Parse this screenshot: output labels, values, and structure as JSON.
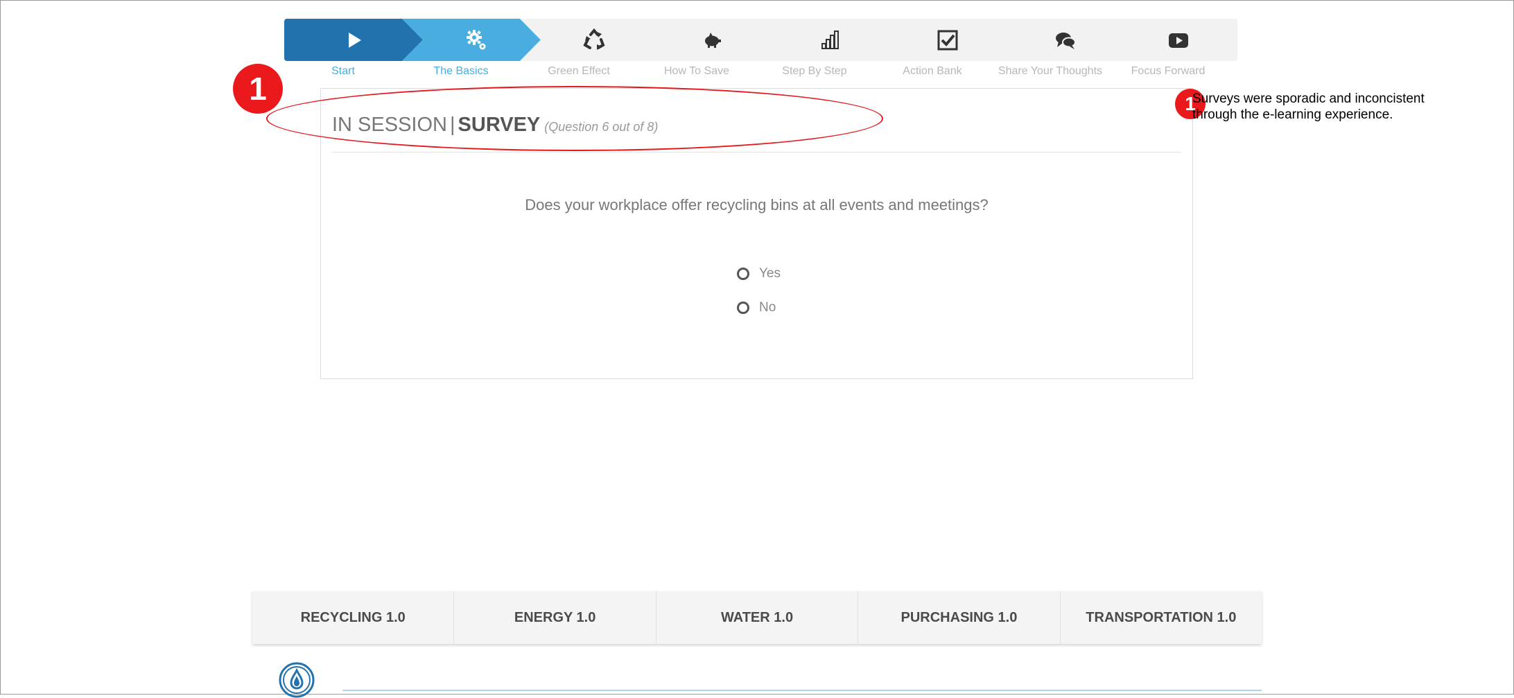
{
  "steps": [
    {
      "label": "Start",
      "icon": "play-icon",
      "state": "done"
    },
    {
      "label": "The Basics",
      "icon": "gears-icon",
      "state": "active"
    },
    {
      "label": "Green Effect",
      "icon": "recycle-icon",
      "state": "todo"
    },
    {
      "label": "How To Save",
      "icon": "piggy-bank-icon",
      "state": "todo"
    },
    {
      "label": "Step By Step",
      "icon": "bar-steps-icon",
      "state": "todo"
    },
    {
      "label": "Action Bank",
      "icon": "checkbox-icon",
      "state": "todo"
    },
    {
      "label": "Share Your Thoughts",
      "icon": "chat-bubbles-icon",
      "state": "todo"
    },
    {
      "label": "Focus Forward",
      "icon": "video-play-icon",
      "state": "todo"
    }
  ],
  "card": {
    "section": "IN SESSION",
    "separator": "|",
    "kind": "SURVEY",
    "progress": "(Question 6 out of 8)",
    "question": "Does your workplace offer recycling bins at all events and meetings?",
    "options": [
      "Yes",
      "No"
    ]
  },
  "annotation": {
    "number": "1",
    "note": "Surveys were sporadic and inconcistent through the e-learning experience."
  },
  "tabs": [
    "RECYCLING 1.0",
    "ENERGY 1.0",
    "WATER 1.0",
    "PURCHASING 1.0",
    "TRANSPORTATION 1.0"
  ],
  "colors": {
    "done": "#2272ae",
    "active": "#4aade0",
    "inactive": "#f2f2f2",
    "annotation": "#e9191c"
  }
}
